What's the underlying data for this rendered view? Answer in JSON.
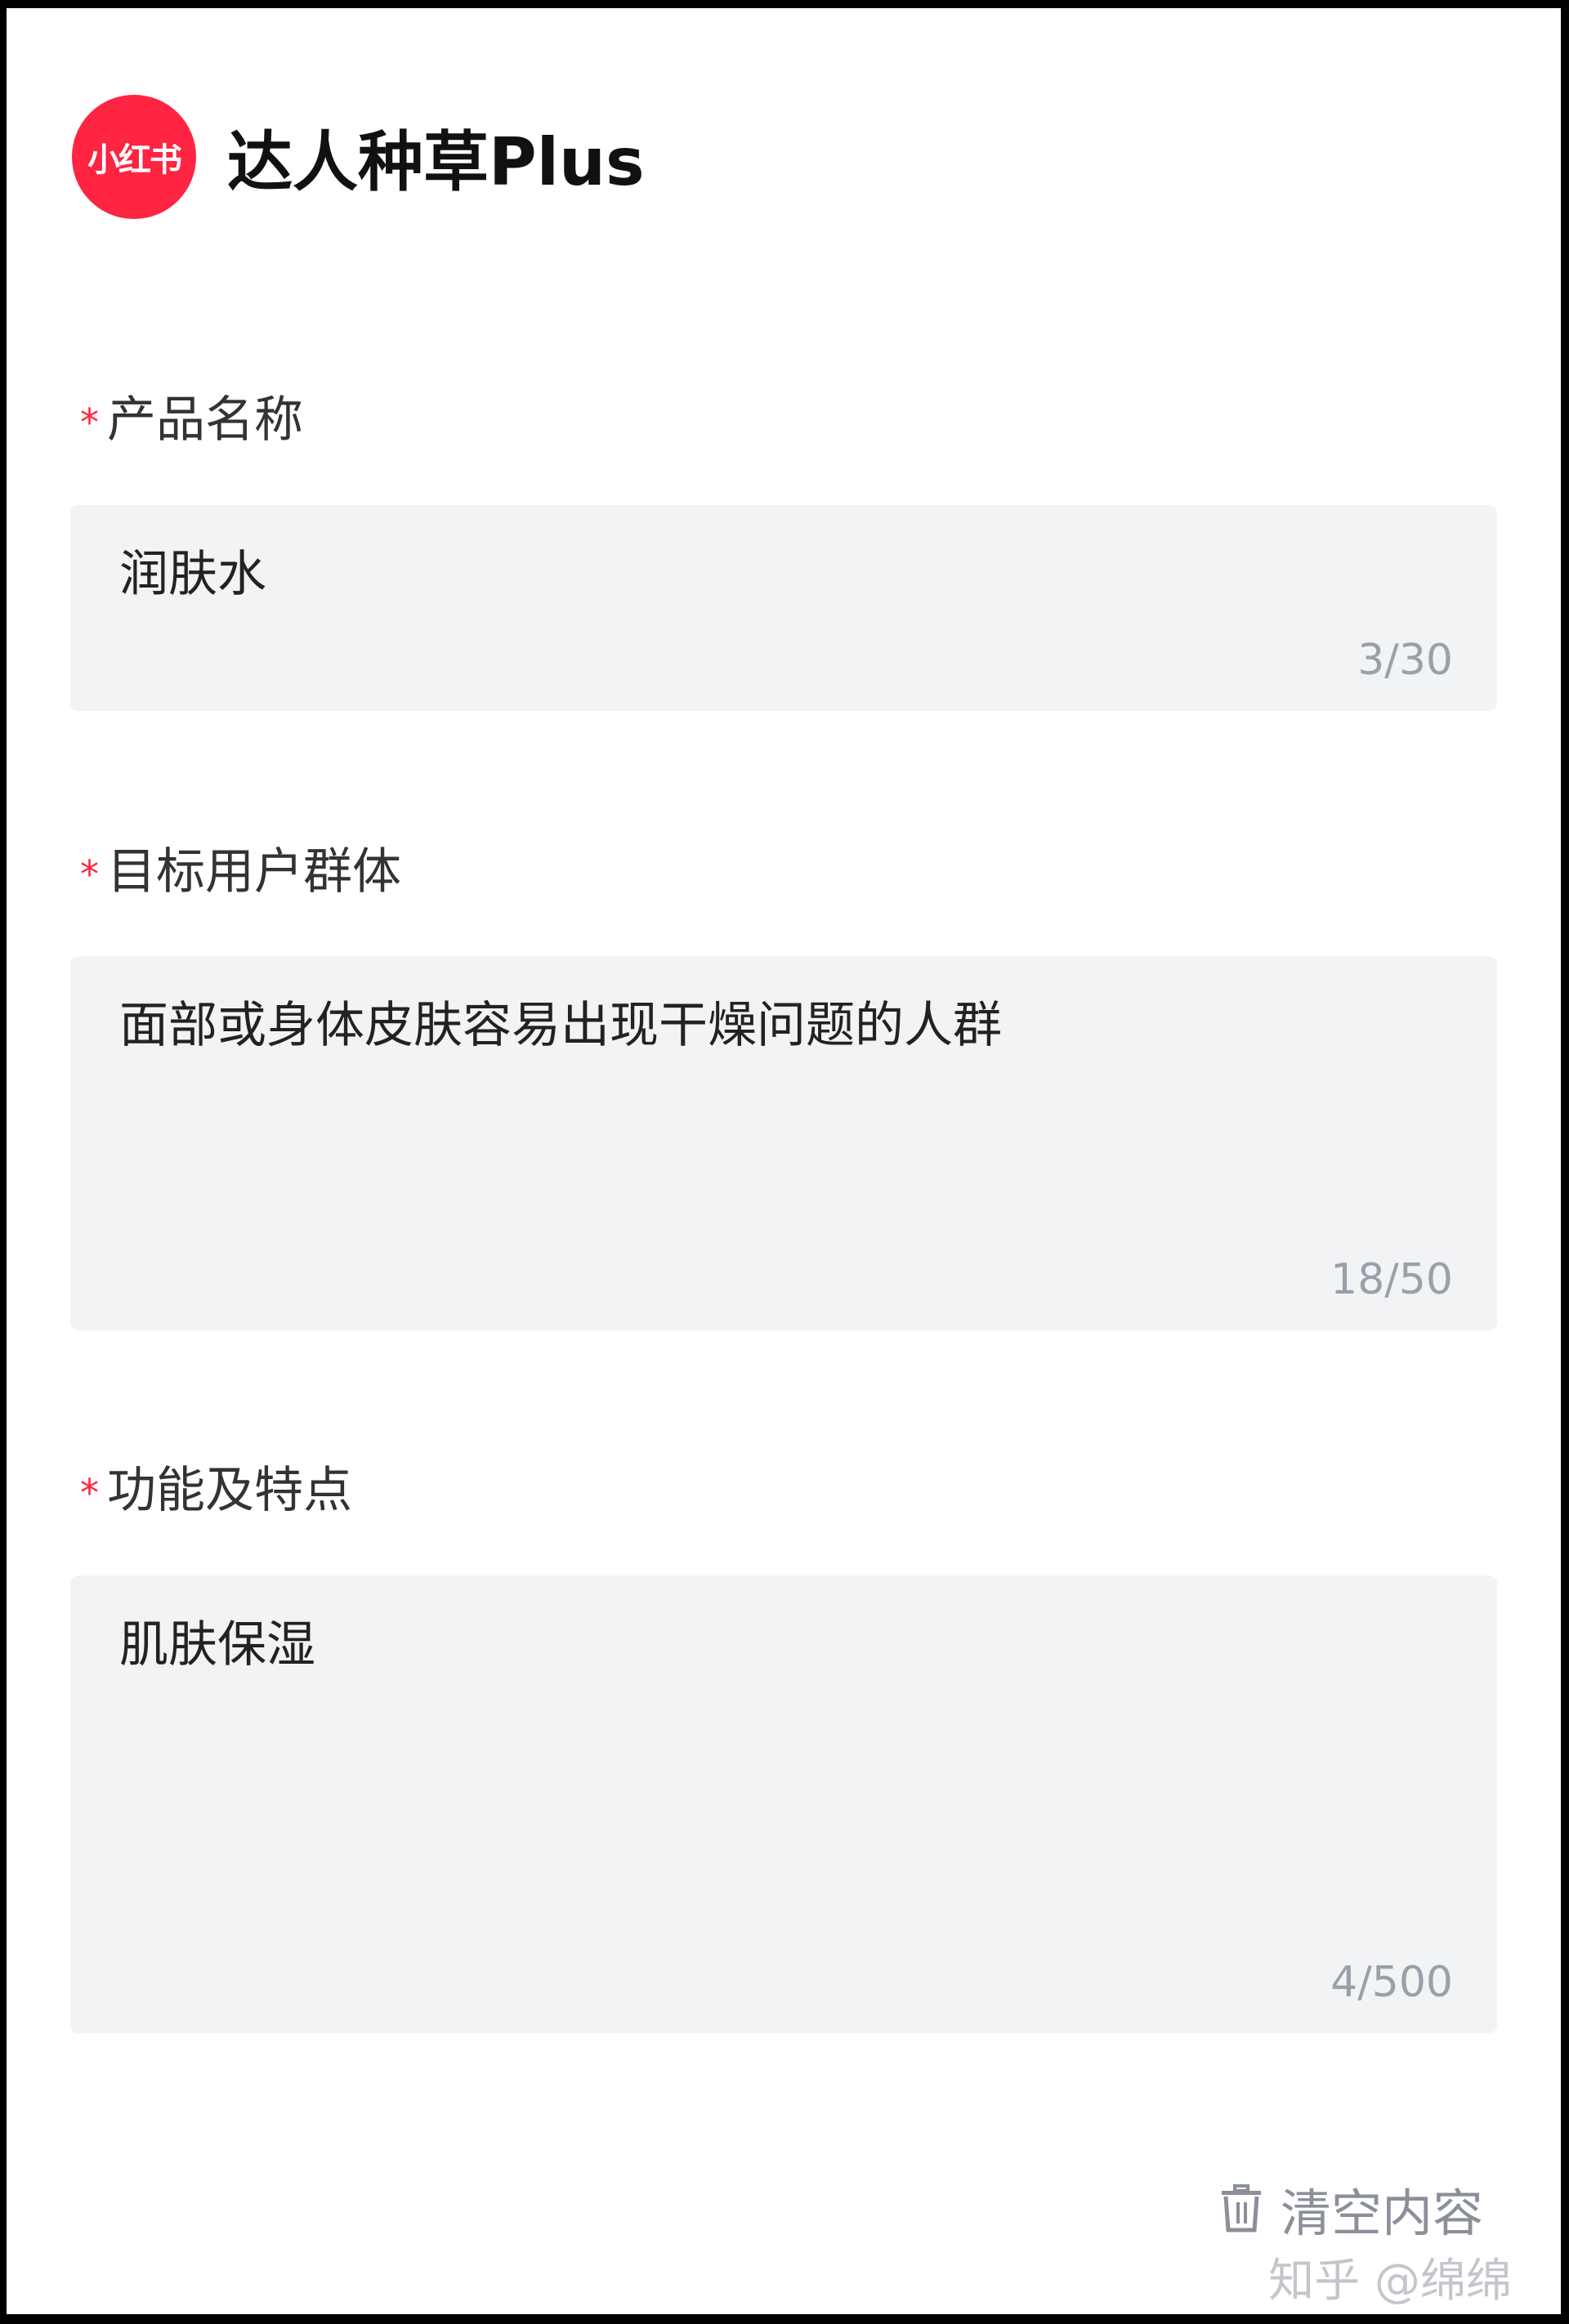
{
  "header": {
    "logo_text": "小红书",
    "app_title": "达人种草Plus"
  },
  "fields": [
    {
      "required_mark": "*",
      "label": "产品名称",
      "value": "润肤水",
      "counter": "3/30"
    },
    {
      "required_mark": "*",
      "label": "目标用户群体",
      "value": "面部或身体皮肤容易出现干燥问题的人群",
      "counter": "18/50"
    },
    {
      "required_mark": "*",
      "label": "功能及特点",
      "value": "肌肤保湿",
      "counter": "4/500"
    }
  ],
  "actions": {
    "clear_label": "清空内容",
    "clear_icon": "trash-icon"
  },
  "watermark": "知乎 @绵绵",
  "colors": {
    "brand": "#ff2442",
    "field_bg": "#f2f3f5",
    "muted": "#9aa0aa"
  }
}
